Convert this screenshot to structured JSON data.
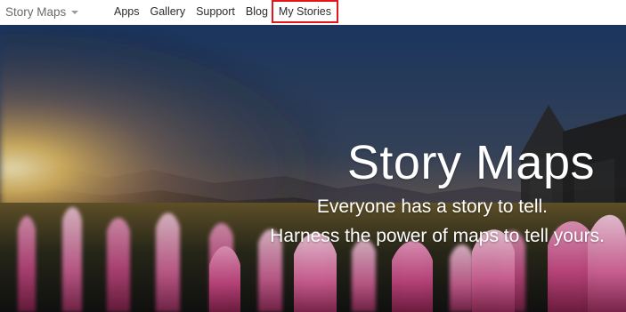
{
  "header": {
    "brand_label": "Story Maps",
    "brand_caret_icon": "chevron-down-icon",
    "nav": {
      "apps": "Apps",
      "gallery": "Gallery",
      "support": "Support",
      "blog": "Blog",
      "my_stories": "My Stories"
    },
    "highlight_color": "#e3161b"
  },
  "hero": {
    "title": "Story Maps",
    "line1": "Everyone has a story to tell.",
    "line2": "Harness the power of maps to tell yours.",
    "colors": {
      "sky_top": "#1f3d6b",
      "sky_mid": "#3e4f6a",
      "sun_glow": "#ffd26a",
      "flowers": "#d04d8a"
    }
  }
}
